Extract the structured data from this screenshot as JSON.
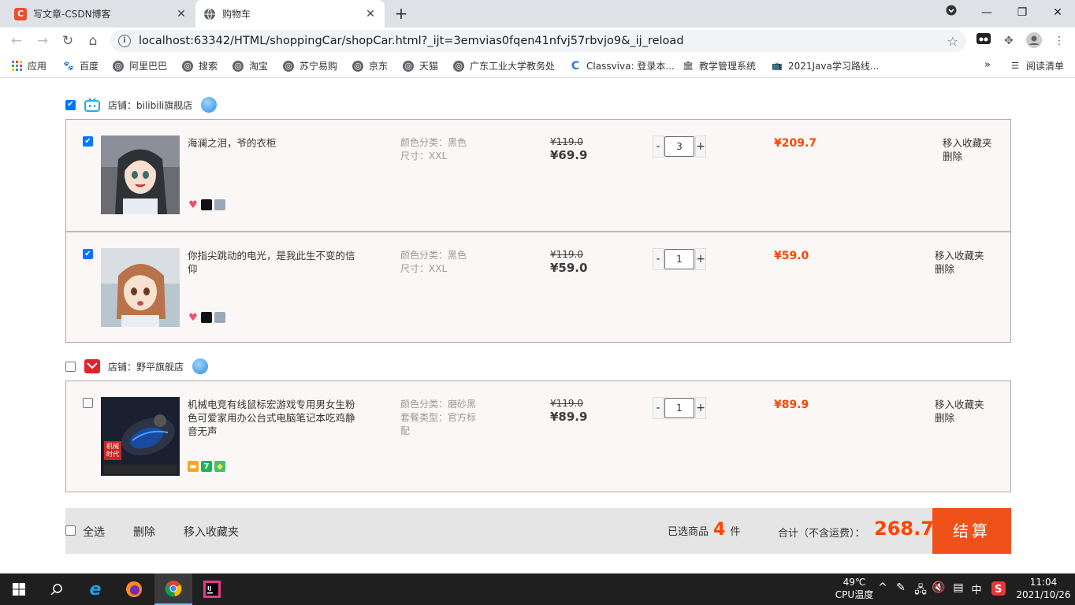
{
  "browser": {
    "tabs": [
      {
        "title": "写文章-CSDN博客",
        "favicon": "C",
        "favicon_color": "#e8502e"
      },
      {
        "title": "购物车",
        "favicon": "globe-icon"
      }
    ],
    "url": "localhost:63342/HTML/shoppingCar/shopCar.html?_ijt=3emvias0fqen41nfvj57rbvjo9&_ij_reload",
    "bookmarks": [
      "应用",
      "百度",
      "阿里巴巴",
      "搜索",
      "淘宝",
      "苏宁易购",
      "京东",
      "天猫",
      "广东工业大学教务处",
      "Classviva: 登录本...",
      "教学管理系统",
      "2021Java学习路线..."
    ],
    "reading_list": "阅读清单"
  },
  "cart": {
    "shops": [
      {
        "name": "店铺：bilibili旗舰店",
        "checked": true,
        "items": [
          {
            "name": "海澜之泪，爷的衣柜",
            "attrs": [
              "颜色分类：黑色",
              "尺寸：XXL"
            ],
            "old_price": "¥119.0",
            "price": "¥69.9",
            "qty": "3",
            "subtotal": "¥209.7",
            "ops": [
              "移入收藏夹",
              "删除"
            ],
            "checked": true
          },
          {
            "name": "你指尖跳动的电光，是我此生不变的信仰",
            "attrs": [
              "颜色分类：黑色",
              "尺寸：XXL"
            ],
            "old_price": "¥119.0",
            "price": "¥59.0",
            "qty": "1",
            "subtotal": "¥59.0",
            "ops": [
              "移入收藏夹",
              "删除"
            ],
            "checked": true
          }
        ]
      },
      {
        "name": "店铺：野平旗舰店",
        "checked": false,
        "items": [
          {
            "name": "机械电竞有线鼠标宏游戏专用男女生粉色可爱家用办公台式电脑笔记本吃鸡静音无声",
            "attrs": [
              "颜色分类：磨砂黑",
              "套餐类型：官方标配"
            ],
            "old_price": "¥119.0",
            "price": "¥89.9",
            "qty": "1",
            "subtotal": "¥89.9",
            "ops": [
              "移入收藏夹",
              "删除"
            ],
            "checked": false,
            "img_text": "机械时代"
          }
        ]
      }
    ],
    "qty_minus": "-",
    "qty_plus": "+",
    "footer": {
      "select_all": "全选",
      "delete": "删除",
      "move_fav": "移入收藏夹",
      "selected_prefix": "已选商品",
      "selected_count": "4",
      "selected_suffix": "件",
      "total_label": "合计（不含运费）：",
      "total": "268.7",
      "checkout": "结算"
    }
  },
  "taskbar": {
    "temp": "49℃",
    "temp_label": "CPU温度",
    "ime": "中",
    "time": "11:04",
    "date": "2021/10/26"
  }
}
